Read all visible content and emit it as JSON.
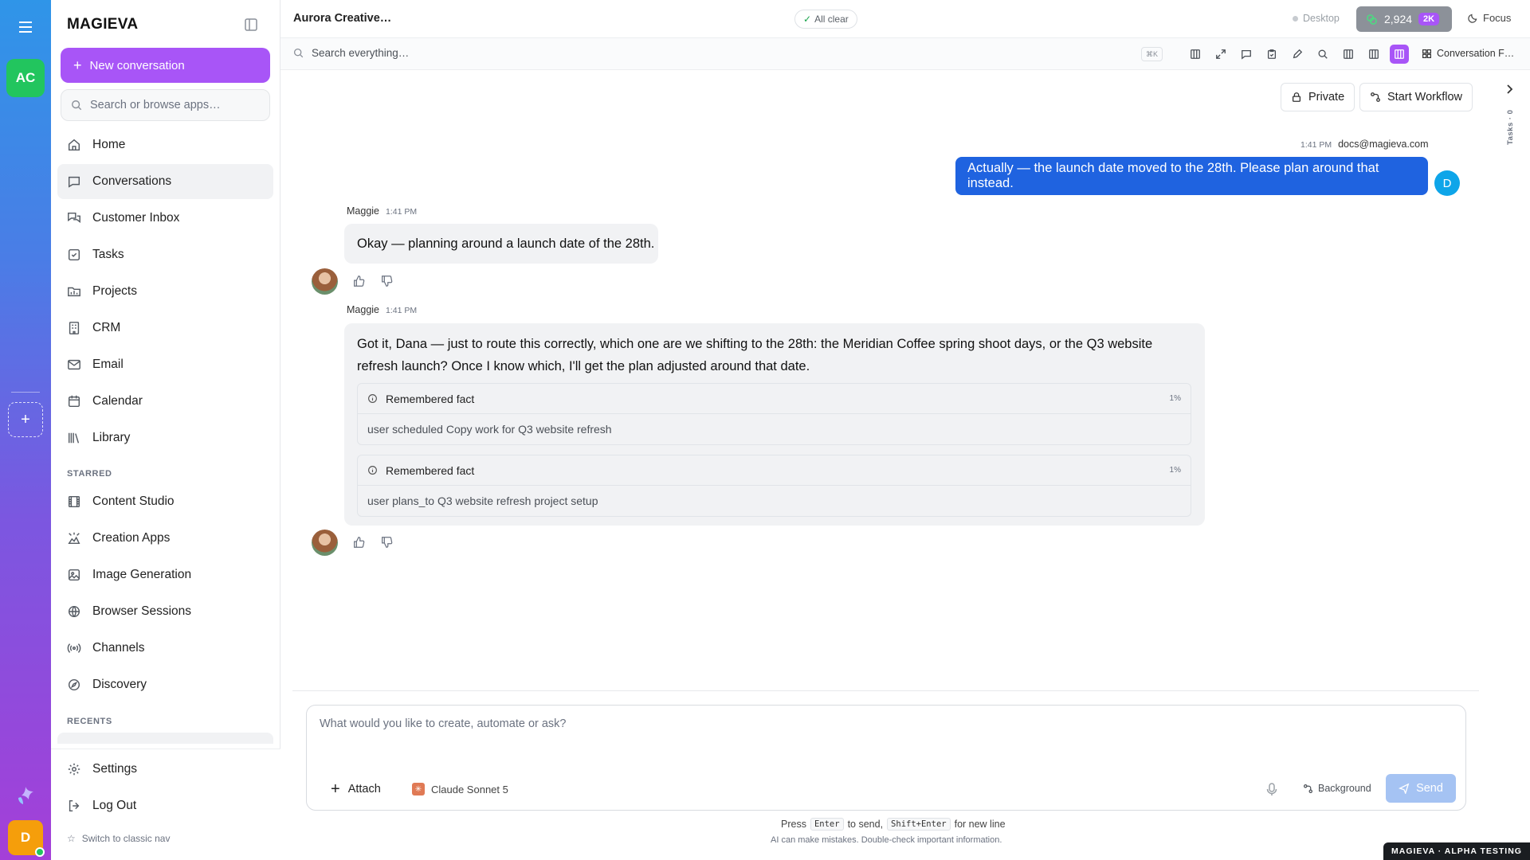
{
  "rail": {
    "workspace_initials": "AC",
    "user_initial": "D",
    "icons": [
      "menu-icon",
      "plus-icon",
      "brand-logo"
    ]
  },
  "sidebar": {
    "brand": "MAGIEVA",
    "new_conversation": "New conversation",
    "search_placeholder": "Search or browse apps…",
    "nav": [
      {
        "label": "Home",
        "icon": "home-icon"
      },
      {
        "label": "Conversations",
        "icon": "chat-icon",
        "active": true
      },
      {
        "label": "Customer Inbox",
        "icon": "inbox-icon"
      },
      {
        "label": "Tasks",
        "icon": "tasks-icon"
      },
      {
        "label": "Projects",
        "icon": "projects-icon"
      },
      {
        "label": "CRM",
        "icon": "crm-icon"
      },
      {
        "label": "Email",
        "icon": "mail-icon"
      },
      {
        "label": "Calendar",
        "icon": "calendar-icon"
      },
      {
        "label": "Library",
        "icon": "library-icon"
      }
    ],
    "starred_label": "STARRED",
    "starred": [
      {
        "label": "Content Studio",
        "icon": "film-icon"
      },
      {
        "label": "Creation Apps",
        "icon": "apps-icon"
      },
      {
        "label": "Image Generation",
        "icon": "image-icon"
      },
      {
        "label": "Browser Sessions",
        "icon": "globe-icon"
      },
      {
        "label": "Channels",
        "icon": "broadcast-icon"
      },
      {
        "label": "Discovery",
        "icon": "compass-icon"
      }
    ],
    "recents_label": "RECENTS",
    "settings": "Settings",
    "logout": "Log Out",
    "switch_nav": "Switch to classic nav"
  },
  "header": {
    "title": "Aurora Creative…",
    "status": "All clear",
    "desktop": "Desktop",
    "credits": "2,924",
    "credits_badge": "2K",
    "focus": "Focus"
  },
  "toolbar": {
    "search_placeholder": "Search everything…",
    "shortcut": "⌘K",
    "panel_label": "Conversation F…"
  },
  "chat": {
    "private_label": "Private",
    "workflow_label": "Start Workflow",
    "tasks_label": "Tasks · 0",
    "user_message": {
      "time": "1:41 PM",
      "author": "docs@magieva.com",
      "text": "Actually — the launch date moved to the 28th. Please plan around that instead.",
      "avatar": "D"
    },
    "assistant_messages": [
      {
        "author": "Maggie",
        "time": "1:41 PM",
        "text": "Okay — planning around a launch date of the 28th."
      },
      {
        "author": "Maggie",
        "time": "1:41 PM",
        "text": "Got it, Dana — just to route this correctly, which one are we shifting to the 28th: the Meridian Coffee spring shoot days, or the Q3 website refresh launch? Once I know which, I'll get the plan adjusted around that date.",
        "facts": [
          {
            "title": "Remembered fact",
            "pct": "1%",
            "body": "user scheduled Copy work for Q3 website refresh"
          },
          {
            "title": "Remembered fact",
            "pct": "1%",
            "body": "user plans_to Q3 website refresh project setup"
          }
        ]
      }
    ]
  },
  "composer": {
    "placeholder": "What would you like to create, automate or ask?",
    "attach": "Attach",
    "model": "Claude Sonnet 5",
    "background": "Background",
    "send": "Send",
    "hint_press": "Press",
    "hint_enter": "Enter",
    "hint_to_send": "to send,",
    "hint_shift": "Shift+Enter",
    "hint_newline": "for new line",
    "disclaimer": "AI can make mistakes. Double-check important information."
  },
  "badge": "MAGIEVA · ALPHA TESTING",
  "colors": {
    "accent": "#a855f7",
    "user_bubble": "#1f63e0",
    "workspace": "#22c55e",
    "user_avatar": "#f59e0b"
  }
}
